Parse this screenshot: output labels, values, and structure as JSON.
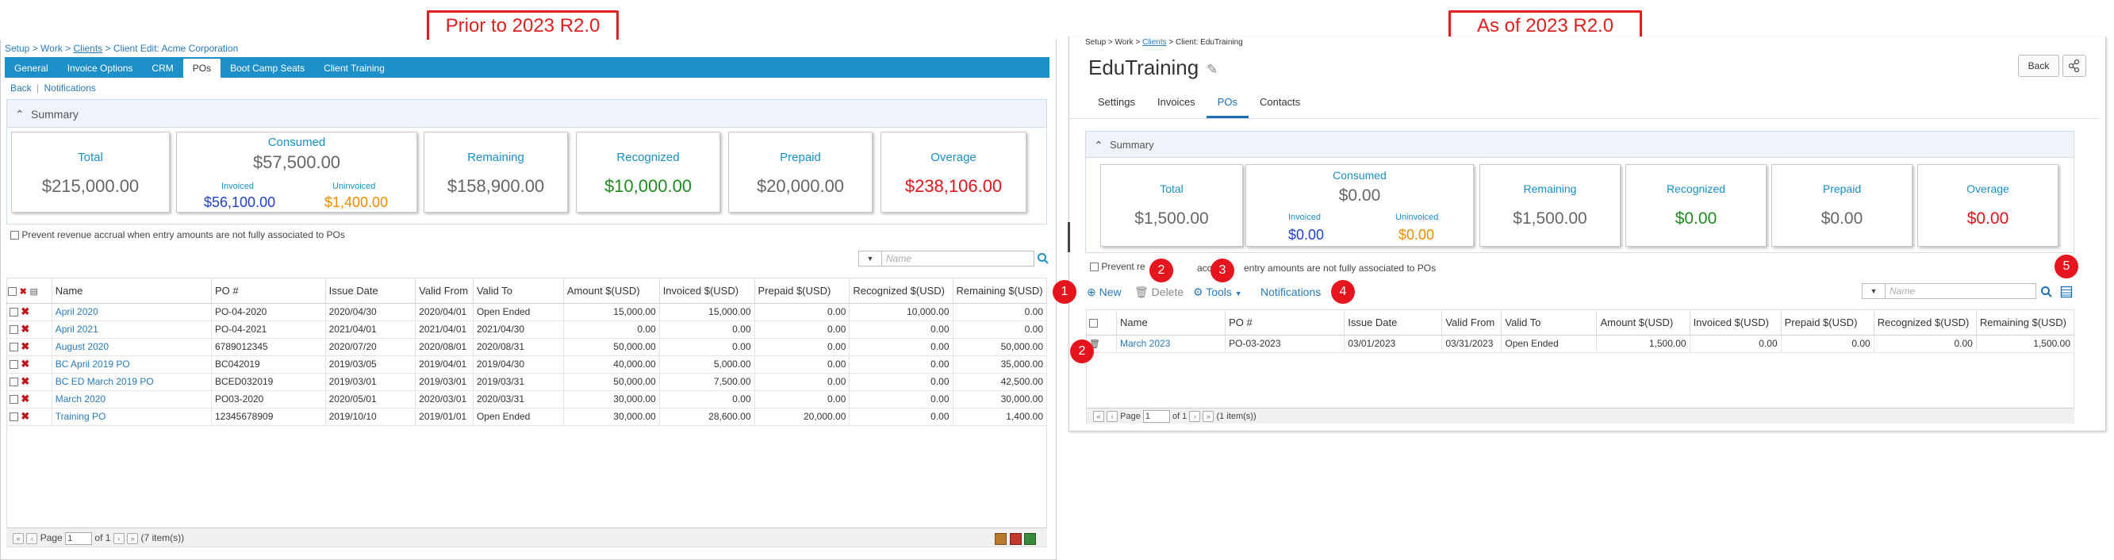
{
  "labels": {
    "before": "Prior to 2023 R2.0",
    "after": "As of 2023 R2.0"
  },
  "old": {
    "breadcrumb": {
      "part1": "Setup > Work > ",
      "link": "Clients",
      "part2": " > Client Edit: Acme Corporation"
    },
    "tabs": [
      "General",
      "Invoice Options",
      "CRM",
      "POs",
      "Boot Camp Seats",
      "Client Training"
    ],
    "back": "Back",
    "sep": "|",
    "notifications": "Notifications",
    "summary_title": "Summary",
    "cards": {
      "total": {
        "title": "Total",
        "value": "$215,000.00"
      },
      "consumed": {
        "title": "Consumed",
        "value": "$57,500.00",
        "invoiced_label": "Invoiced",
        "invoiced": "$56,100.00",
        "uninvoiced_label": "Uninvoiced",
        "uninvoiced": "$1,400.00"
      },
      "remaining": {
        "title": "Remaining",
        "value": "$158,900.00"
      },
      "recognized": {
        "title": "Recognized",
        "value": "$10,000.00"
      },
      "prepaid": {
        "title": "Prepaid",
        "value": "$20,000.00"
      },
      "overage": {
        "title": "Overage",
        "value": "$238,106.00"
      }
    },
    "prevent": "Prevent revenue accrual when entry amounts are not fully associated to POs",
    "search_placeholder": "Name",
    "columns": [
      "Name",
      "PO #",
      "Issue Date",
      "Valid From",
      "Valid To",
      "Amount $(USD)",
      "Invoiced $(USD)",
      "Prepaid $(USD)",
      "Recognized $(USD)",
      "Remaining $(USD)"
    ],
    "rows": [
      [
        "April 2020",
        "PO-04-2020",
        "2020/04/30",
        "2020/04/01",
        "Open Ended",
        "15,000.00",
        "15,000.00",
        "0.00",
        "10,000.00",
        "0.00"
      ],
      [
        "April 2021",
        "PO-04-2021",
        "2021/04/01",
        "2021/04/01",
        "2021/04/30",
        "0.00",
        "0.00",
        "0.00",
        "0.00",
        "0.00"
      ],
      [
        "August 2020",
        "6789012345",
        "2020/07/20",
        "2020/08/01",
        "2020/08/31",
        "50,000.00",
        "0.00",
        "0.00",
        "0.00",
        "50,000.00"
      ],
      [
        "BC April 2019 PO",
        "BC042019",
        "2019/03/05",
        "2019/04/01",
        "2019/04/30",
        "40,000.00",
        "5,000.00",
        "0.00",
        "0.00",
        "35,000.00"
      ],
      [
        "BC ED March 2019 PO",
        "BCED032019",
        "2019/03/01",
        "2019/03/01",
        "2019/03/31",
        "50,000.00",
        "7,500.00",
        "0.00",
        "0.00",
        "42,500.00"
      ],
      [
        "March 2020",
        "PO03-2020",
        "2020/05/01",
        "2020/03/01",
        "2020/03/31",
        "30,000.00",
        "0.00",
        "0.00",
        "0.00",
        "30,000.00"
      ],
      [
        "Training PO",
        "12345678909",
        "2019/10/10",
        "2019/01/01",
        "Open Ended",
        "30,000.00",
        "28,600.00",
        "20,000.00",
        "0.00",
        "1,400.00"
      ]
    ],
    "pager": {
      "page": "Page",
      "value": "1",
      "of": "of 1",
      "items": "(7 item(s))"
    }
  },
  "new": {
    "breadcrumb": {
      "part1": "Setup > Work > ",
      "link": "Clients",
      "part2": " > Client: EduTraining"
    },
    "title": "EduTraining",
    "back": "Back",
    "tabs": [
      "Settings",
      "Invoices",
      "POs",
      "Contacts"
    ],
    "summary_title": "Summary",
    "cards": {
      "total": {
        "title": "Total",
        "value": "$1,500.00"
      },
      "consumed": {
        "title": "Consumed",
        "value": "$0.00",
        "invoiced_label": "Invoiced",
        "invoiced": "$0.00",
        "uninvoiced_label": "Uninvoiced",
        "uninvoiced": "$0.00"
      },
      "remaining": {
        "title": "Remaining",
        "value": "$1,500.00"
      },
      "recognized": {
        "title": "Recognized",
        "value": "$0.00"
      },
      "prepaid": {
        "title": "Prepaid",
        "value": "$0.00"
      },
      "overage": {
        "title": "Overage",
        "value": "$0.00"
      }
    },
    "prevent_a": "Prevent re",
    "prevent_b": "accrual",
    "prevent_c": "entry amounts are not fully associated to POs",
    "toolbar": {
      "new": "New",
      "delete": "Delete",
      "tools": "Tools",
      "notifications": "Notifications"
    },
    "badges": [
      "1",
      "2",
      "3",
      "4",
      "5",
      "2"
    ],
    "search_placeholder": "Name",
    "columns": [
      "Name",
      "PO #",
      "Issue Date",
      "Valid From",
      "Valid To",
      "Amount $(USD)",
      "Invoiced $(USD)",
      "Prepaid $(USD)",
      "Recognized $(USD)",
      "Remaining $(USD)"
    ],
    "rows": [
      [
        "March 2023",
        "PO-03-2023",
        "03/01/2023",
        "03/31/2023",
        "Open Ended",
        "1,500.00",
        "0.00",
        "0.00",
        "0.00",
        "1,500.00"
      ]
    ],
    "pager": {
      "page": "Page",
      "value": "1",
      "of": "of 1",
      "items": "(1 item(s))"
    }
  },
  "colors": {
    "blue_tab": "#1d8fc9",
    "invoiced": "#1f3fd1",
    "uninvoiced": "#f08a00",
    "recognized": "#1f8a1f",
    "overage": "#e0141c",
    "badge": "#e6141c"
  }
}
